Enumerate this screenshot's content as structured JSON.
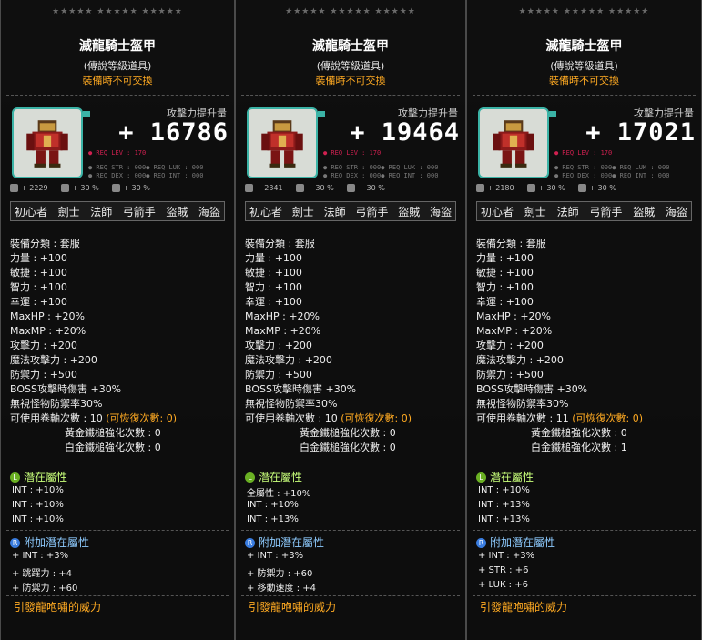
{
  "panels": [
    {
      "stars": "★★★★★ ★★★★★ ★★★★★",
      "title": "滅龍騎士盔甲",
      "grade": "(傳說等級道具)",
      "untradable": "裝備時不可交換",
      "attack_label": "攻擊力提升量",
      "attack_value": "+ 16786",
      "req_lev": "● REQ LEV :    170",
      "req_str": "● REQ STR : 000●  REQ LUK : 000",
      "req_dex": "● REQ DEX : 000●  REQ INT : 000",
      "bonus": [
        "+ 2229",
        "+ 30 %",
        "+ 30 %"
      ],
      "jobs": [
        "初心者",
        "劍士",
        "法師",
        "弓箭手",
        "盜賊",
        "海盜"
      ],
      "stats": [
        "裝備分類 : 套服",
        "力量 : +100",
        "敏捷 : +100",
        "智力 : +100",
        "幸運 : +100",
        "MaxHP : +20%",
        "MaxMP : +20%",
        "攻擊力 : +200",
        "魔法攻擊力 : +200",
        "防禦力 : +500",
        "BOSS攻擊時傷害 +30%",
        "無視怪物防禦率30%"
      ],
      "scroll_label": "可使用卷軸次數 : 10",
      "scroll_recover": "(可恢復次數: 0)",
      "gold_hammer": "黃金鐵槌強化次數 : 0",
      "plat_hammer": "白金鐵槌強化次數 : 0",
      "potential_head": "潛在屬性",
      "potential": [
        "INT : +10%",
        "INT : +10%",
        "INT : +10%"
      ],
      "bonus_potential_head": "附加潛在屬性",
      "bonus_potential": [
        "+ INT : +3%",
        "+ 跳躍力 : +4",
        "+ 防禦力 : +60"
      ],
      "flavor": "引發龍咆嘯的威力"
    },
    {
      "stars": "★★★★★ ★★★★★ ★★★★★",
      "title": "滅龍騎士盔甲",
      "grade": "(傳說等級道具)",
      "untradable": "裝備時不可交換",
      "attack_label": "攻擊力提升量",
      "attack_value": "+ 19464",
      "req_lev": "● REQ LEV :    170",
      "req_str": "● REQ STR : 000●  REQ LUK : 000",
      "req_dex": "● REQ DEX : 000●  REQ INT : 000",
      "bonus": [
        "+ 2341",
        "+ 30 %",
        "+ 30 %"
      ],
      "jobs": [
        "初心者",
        "劍士",
        "法師",
        "弓箭手",
        "盜賊",
        "海盜"
      ],
      "stats": [
        "裝備分類 : 套服",
        "力量 : +100",
        "敏捷 : +100",
        "智力 : +100",
        "幸運 : +100",
        "MaxHP : +20%",
        "MaxMP : +20%",
        "攻擊力 : +200",
        "魔法攻擊力 : +200",
        "防禦力 : +500",
        "BOSS攻擊時傷害 +30%",
        "無視怪物防禦率30%"
      ],
      "scroll_label": "可使用卷軸次數 : 10",
      "scroll_recover": "(可恢復次數: 0)",
      "gold_hammer": "黃金鐵槌強化次數 : 0",
      "plat_hammer": "白金鐵槌強化次數 : 0",
      "potential_head": "潛在屬性",
      "potential": [
        "全屬性 : +10%",
        "INT : +10%",
        "INT : +13%"
      ],
      "bonus_potential_head": "附加潛在屬性",
      "bonus_potential": [
        "+ INT : +3%",
        "+ 防禦力 : +60",
        "+ 移動速度 : +4"
      ],
      "flavor": "引發龍咆嘯的威力"
    },
    {
      "stars": "★★★★★ ★★★★★ ★★★★★",
      "title": "滅龍騎士盔甲",
      "grade": "(傳說等級道具)",
      "untradable": "裝備時不可交換",
      "attack_label": "攻擊力提升量",
      "attack_value": "+ 17021",
      "req_lev": "● REQ LEV :    170",
      "req_str": "● REQ STR : 000●  REQ LUK : 000",
      "req_dex": "● REQ DEX : 000●  REQ INT : 000",
      "bonus": [
        "+ 2180",
        "+ 30 %",
        "+ 30 %"
      ],
      "jobs": [
        "初心者",
        "劍士",
        "法師",
        "弓箭手",
        "盜賊",
        "海盜"
      ],
      "stats": [
        "裝備分類 : 套服",
        "力量 : +100",
        "敏捷 : +100",
        "智力 : +100",
        "幸運 : +100",
        "MaxHP : +20%",
        "MaxMP : +20%",
        "攻擊力 : +200",
        "魔法攻擊力 : +200",
        "防禦力 : +500",
        "BOSS攻擊時傷害 +30%",
        "無視怪物防禦率30%"
      ],
      "scroll_label": "可使用卷軸次數 : 11",
      "scroll_recover": "(可恢復次數: 0)",
      "gold_hammer": "黃金鐵槌強化次數 : 0",
      "plat_hammer": "白金鐵槌強化次數 : 1",
      "potential_head": "潛在屬性",
      "potential": [
        "INT : +10%",
        "INT : +13%",
        "INT : +13%"
      ],
      "bonus_potential_head": "附加潛在屬性",
      "bonus_potential": [
        "+ INT : +3%",
        "+ STR : +6",
        "+ LUK : +6"
      ],
      "flavor": "引發龍咆嘯的威力"
    }
  ],
  "colors": {
    "accent": "#3bb3a6",
    "orange": "#ffaa22",
    "potential": "#c8ff7a",
    "bonus_potential": "#8ecbff",
    "req_lev": "#d02050"
  }
}
